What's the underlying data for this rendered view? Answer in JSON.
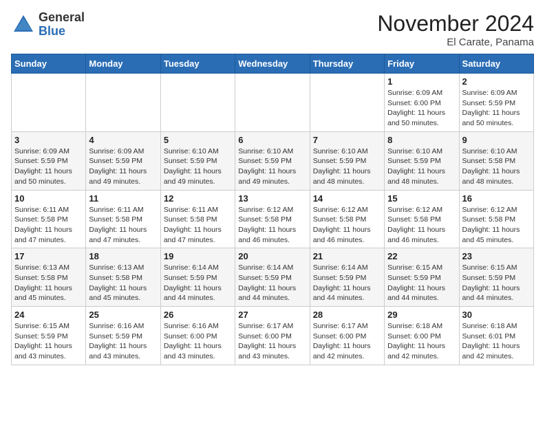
{
  "header": {
    "logo_general": "General",
    "logo_blue": "Blue",
    "month_title": "November 2024",
    "subtitle": "El Carate, Panama"
  },
  "weekdays": [
    "Sunday",
    "Monday",
    "Tuesday",
    "Wednesday",
    "Thursday",
    "Friday",
    "Saturday"
  ],
  "weeks": [
    [
      {
        "day": "",
        "info": ""
      },
      {
        "day": "",
        "info": ""
      },
      {
        "day": "",
        "info": ""
      },
      {
        "day": "",
        "info": ""
      },
      {
        "day": "",
        "info": ""
      },
      {
        "day": "1",
        "info": "Sunrise: 6:09 AM\nSunset: 6:00 PM\nDaylight: 11 hours\nand 50 minutes."
      },
      {
        "day": "2",
        "info": "Sunrise: 6:09 AM\nSunset: 5:59 PM\nDaylight: 11 hours\nand 50 minutes."
      }
    ],
    [
      {
        "day": "3",
        "info": "Sunrise: 6:09 AM\nSunset: 5:59 PM\nDaylight: 11 hours\nand 50 minutes."
      },
      {
        "day": "4",
        "info": "Sunrise: 6:09 AM\nSunset: 5:59 PM\nDaylight: 11 hours\nand 49 minutes."
      },
      {
        "day": "5",
        "info": "Sunrise: 6:10 AM\nSunset: 5:59 PM\nDaylight: 11 hours\nand 49 minutes."
      },
      {
        "day": "6",
        "info": "Sunrise: 6:10 AM\nSunset: 5:59 PM\nDaylight: 11 hours\nand 49 minutes."
      },
      {
        "day": "7",
        "info": "Sunrise: 6:10 AM\nSunset: 5:59 PM\nDaylight: 11 hours\nand 48 minutes."
      },
      {
        "day": "8",
        "info": "Sunrise: 6:10 AM\nSunset: 5:59 PM\nDaylight: 11 hours\nand 48 minutes."
      },
      {
        "day": "9",
        "info": "Sunrise: 6:10 AM\nSunset: 5:58 PM\nDaylight: 11 hours\nand 48 minutes."
      }
    ],
    [
      {
        "day": "10",
        "info": "Sunrise: 6:11 AM\nSunset: 5:58 PM\nDaylight: 11 hours\nand 47 minutes."
      },
      {
        "day": "11",
        "info": "Sunrise: 6:11 AM\nSunset: 5:58 PM\nDaylight: 11 hours\nand 47 minutes."
      },
      {
        "day": "12",
        "info": "Sunrise: 6:11 AM\nSunset: 5:58 PM\nDaylight: 11 hours\nand 47 minutes."
      },
      {
        "day": "13",
        "info": "Sunrise: 6:12 AM\nSunset: 5:58 PM\nDaylight: 11 hours\nand 46 minutes."
      },
      {
        "day": "14",
        "info": "Sunrise: 6:12 AM\nSunset: 5:58 PM\nDaylight: 11 hours\nand 46 minutes."
      },
      {
        "day": "15",
        "info": "Sunrise: 6:12 AM\nSunset: 5:58 PM\nDaylight: 11 hours\nand 46 minutes."
      },
      {
        "day": "16",
        "info": "Sunrise: 6:12 AM\nSunset: 5:58 PM\nDaylight: 11 hours\nand 45 minutes."
      }
    ],
    [
      {
        "day": "17",
        "info": "Sunrise: 6:13 AM\nSunset: 5:58 PM\nDaylight: 11 hours\nand 45 minutes."
      },
      {
        "day": "18",
        "info": "Sunrise: 6:13 AM\nSunset: 5:58 PM\nDaylight: 11 hours\nand 45 minutes."
      },
      {
        "day": "19",
        "info": "Sunrise: 6:14 AM\nSunset: 5:59 PM\nDaylight: 11 hours\nand 44 minutes."
      },
      {
        "day": "20",
        "info": "Sunrise: 6:14 AM\nSunset: 5:59 PM\nDaylight: 11 hours\nand 44 minutes."
      },
      {
        "day": "21",
        "info": "Sunrise: 6:14 AM\nSunset: 5:59 PM\nDaylight: 11 hours\nand 44 minutes."
      },
      {
        "day": "22",
        "info": "Sunrise: 6:15 AM\nSunset: 5:59 PM\nDaylight: 11 hours\nand 44 minutes."
      },
      {
        "day": "23",
        "info": "Sunrise: 6:15 AM\nSunset: 5:59 PM\nDaylight: 11 hours\nand 44 minutes."
      }
    ],
    [
      {
        "day": "24",
        "info": "Sunrise: 6:15 AM\nSunset: 5:59 PM\nDaylight: 11 hours\nand 43 minutes."
      },
      {
        "day": "25",
        "info": "Sunrise: 6:16 AM\nSunset: 5:59 PM\nDaylight: 11 hours\nand 43 minutes."
      },
      {
        "day": "26",
        "info": "Sunrise: 6:16 AM\nSunset: 6:00 PM\nDaylight: 11 hours\nand 43 minutes."
      },
      {
        "day": "27",
        "info": "Sunrise: 6:17 AM\nSunset: 6:00 PM\nDaylight: 11 hours\nand 43 minutes."
      },
      {
        "day": "28",
        "info": "Sunrise: 6:17 AM\nSunset: 6:00 PM\nDaylight: 11 hours\nand 42 minutes."
      },
      {
        "day": "29",
        "info": "Sunrise: 6:18 AM\nSunset: 6:00 PM\nDaylight: 11 hours\nand 42 minutes."
      },
      {
        "day": "30",
        "info": "Sunrise: 6:18 AM\nSunset: 6:01 PM\nDaylight: 11 hours\nand 42 minutes."
      }
    ]
  ]
}
